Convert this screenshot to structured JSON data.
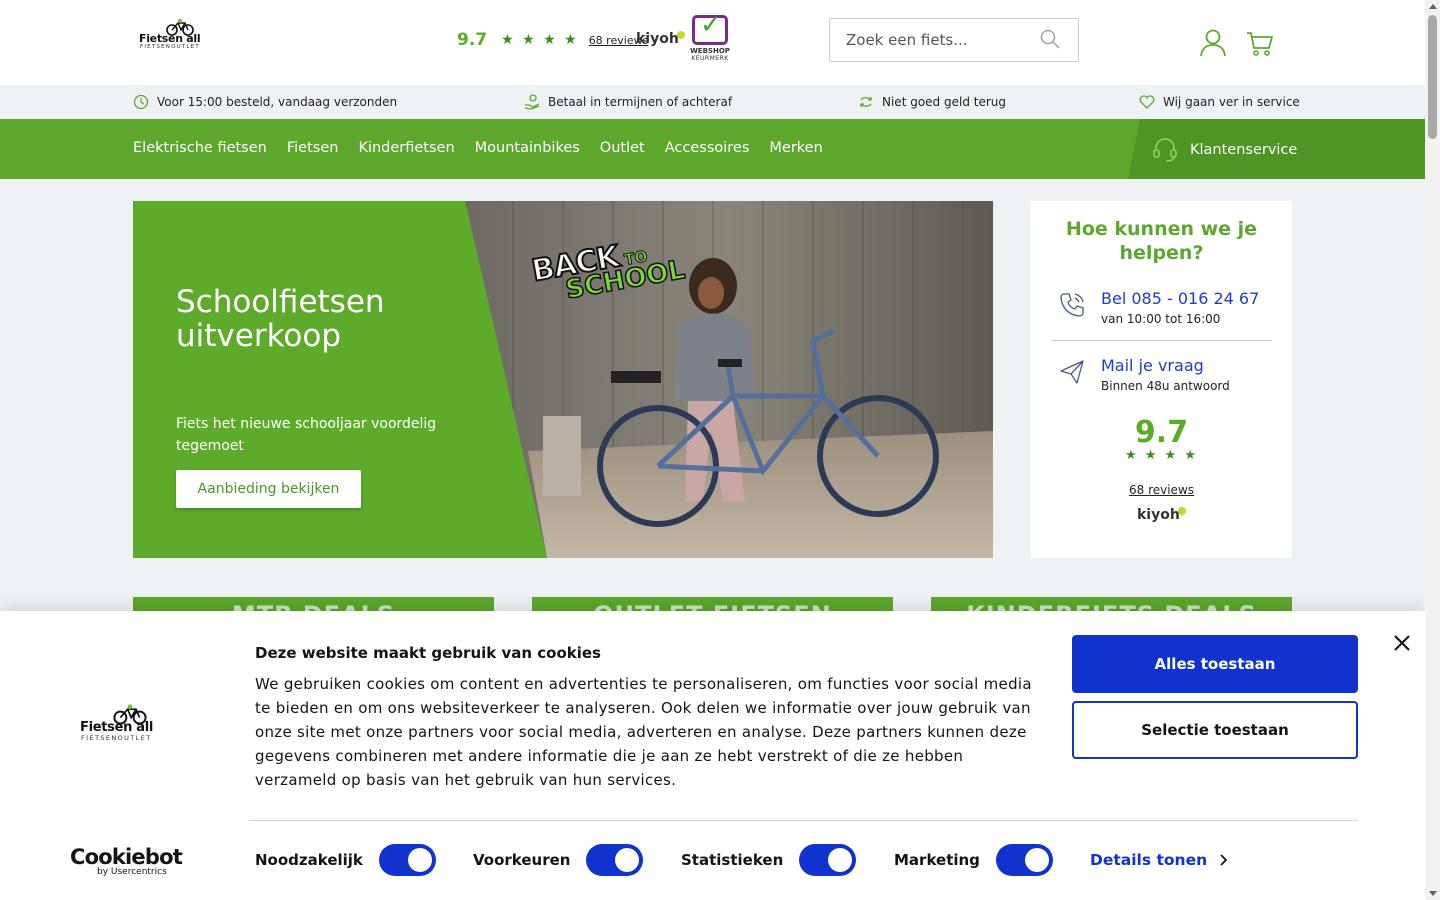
{
  "header": {
    "logo": {
      "name": "Fietsen 4 all",
      "text": "Fietsen all",
      "sub": "FIETSENOUTLET"
    },
    "rating": {
      "score": "9.7",
      "stars": "★ ★ ★ ★",
      "reviews": "68 reviews"
    },
    "kiyoh": "kiyoh",
    "keurmerk": {
      "line1": "WEBSHOP",
      "line2": "KEURMERK"
    },
    "search": {
      "placeholder": "Zoek een fiets...",
      "value": ""
    }
  },
  "usp": [
    {
      "icon": "clock-icon",
      "label": "Voor 15:00 besteld, vandaag verzonden"
    },
    {
      "icon": "hand-coin-icon",
      "label": "Betaal in termijnen of achteraf"
    },
    {
      "icon": "refresh-icon",
      "label": "Niet goed geld terug"
    },
    {
      "icon": "heart-icon",
      "label": "Wij gaan ver in service"
    }
  ],
  "nav": {
    "items": [
      "Elektrische fietsen",
      "Fietsen",
      "Kinderfietsen",
      "Mountainbikes",
      "Outlet",
      "Accessoires",
      "Merken"
    ],
    "service": "Klantenservice"
  },
  "hero": {
    "title": "Schoolfietsen uitverkoop",
    "subtitle": "Fiets het nieuwe schooljaar voordelig tegemoet",
    "button": "Aanbieding bekijken",
    "badge": {
      "back": "BACK",
      "to": "TO",
      "school": "SCHOOL"
    }
  },
  "help": {
    "title": "Hoe kunnen we je helpen?",
    "phone": {
      "title": "Bel 085 - 016 24 67",
      "sub": "van 10:00 tot 16:00"
    },
    "mail": {
      "title": "Mail je vraag",
      "sub": "Binnen 48u antwoord"
    },
    "score": "9.7",
    "stars": "★ ★ ★ ★",
    "reviews": "68 reviews",
    "kiyoh": "kiyoh"
  },
  "deals": [
    "MTB DEALS",
    "OUTLET FIETSEN",
    "KINDERFIETS DEALS"
  ],
  "cookie": {
    "title": "Deze website maakt gebruik van cookies",
    "text": "We gebruiken cookies om content en advertenties te personaliseren, om functies voor social media te bieden en om ons websiteverkeer te analyseren. Ook delen we informatie over jouw gebruik van onze site met onze partners voor social media, adverteren en analyse. Deze partners kunnen deze gegevens combineren met andere informatie die je aan ze hebt verstrekt of die ze hebben verzameld op basis van het gebruik van hun services.",
    "allow_all": "Alles toestaan",
    "allow_selection": "Selectie toestaan",
    "toggles": [
      {
        "label": "Noodzakelijk",
        "checked": true
      },
      {
        "label": "Voorkeuren",
        "checked": true
      },
      {
        "label": "Statistieken",
        "checked": true
      },
      {
        "label": "Marketing",
        "checked": true
      }
    ],
    "details": "Details tonen",
    "brand": {
      "name": "Cookiebot",
      "by": "by Usercentrics"
    }
  },
  "colors": {
    "green": "#5da82c",
    "dark_green": "#4e9525",
    "blue": "#1032cf",
    "link_blue": "#1b3ccf"
  }
}
